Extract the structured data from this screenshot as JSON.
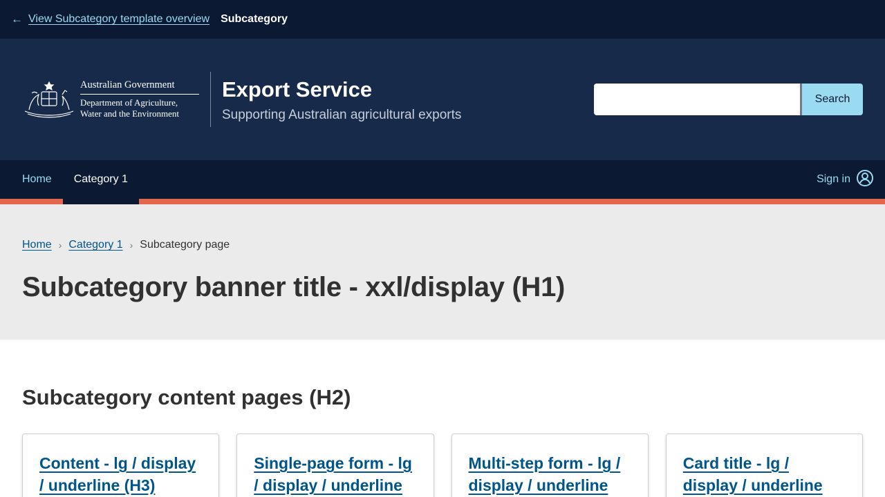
{
  "topbar": {
    "back_arrow": "←",
    "back_link": "View Subcategory template overview",
    "current": "Subcategory"
  },
  "header": {
    "gov_name": "Australian Government",
    "dept_line1": "Department of Agriculture,",
    "dept_line2": "Water and the Environment",
    "service_title": "Export Service",
    "service_subtitle": "Supporting Australian agricultural exports",
    "search": {
      "value": "",
      "placeholder": "",
      "button_label": "Search"
    }
  },
  "nav": {
    "items": [
      {
        "label": "Home"
      },
      {
        "label": "Category 1"
      }
    ],
    "signin_label": "Sign in",
    "accent_color": "#e2674d"
  },
  "banner": {
    "breadcrumbs": [
      "Home",
      "Category 1"
    ],
    "breadcrumb_current": "Subcategory page",
    "title": "Subcategory banner title - xxl/display (H1)"
  },
  "main": {
    "section_title": "Subcategory content pages (H2)",
    "cards": [
      {
        "title": "Content - lg / display / underline (H3)"
      },
      {
        "title": "Single-page form - lg / display / underline"
      },
      {
        "title": "Multi-step form - lg / display / underline"
      },
      {
        "title": "Card title - lg / display / underline"
      }
    ]
  },
  "colors": {
    "topbar_bg": "#0b1933",
    "header_bg": "#182a4a",
    "link_light": "#9adbf1",
    "link_dark": "#00558b",
    "banner_bg": "#ebebeb"
  }
}
